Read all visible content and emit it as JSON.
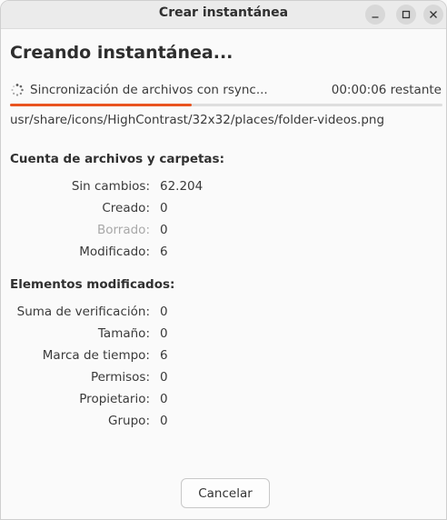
{
  "window": {
    "title": "Crear instantánea"
  },
  "heading": "Creando instantánea...",
  "status": {
    "text": "Sincronización de archivos con rsync...",
    "time_remaining": "00:00:06 restante",
    "progress_fraction": 0.42,
    "current_file": "usr/share/icons/HighContrast/32x32/places/folder-videos.png"
  },
  "file_counts": {
    "title": "Cuenta de archivos y carpetas:",
    "rows": [
      {
        "label": "Sin cambios:",
        "value": "62.204",
        "dim": false
      },
      {
        "label": "Creado:",
        "value": "0",
        "dim": false
      },
      {
        "label": "Borrado:",
        "value": "0",
        "dim": true
      },
      {
        "label": "Modificado:",
        "value": "6",
        "dim": false
      }
    ]
  },
  "modified_items": {
    "title": "Elementos modificados:",
    "rows": [
      {
        "label": "Suma de verificación:",
        "value": "0"
      },
      {
        "label": "Tamaño:",
        "value": "0"
      },
      {
        "label": "Marca de tiempo:",
        "value": "6"
      },
      {
        "label": "Permisos:",
        "value": "0"
      },
      {
        "label": "Propietario:",
        "value": "0"
      },
      {
        "label": "Grupo:",
        "value": "0"
      }
    ]
  },
  "buttons": {
    "cancel": "Cancelar"
  },
  "colors": {
    "accent": "#e95420"
  },
  "icons": {
    "minimize": "minimize-icon",
    "maximize": "maximize-icon",
    "close": "close-icon",
    "spinner": "spinner-icon"
  }
}
